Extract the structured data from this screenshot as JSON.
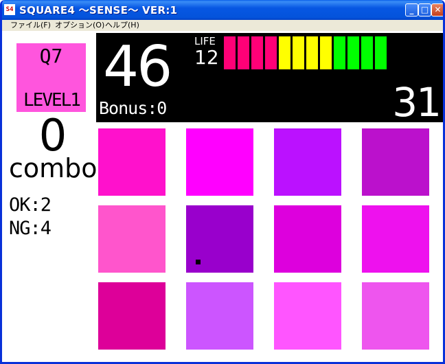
{
  "window": {
    "title": "SQUARE4 ～SENSE～ VER:1",
    "icon_text": "S4"
  },
  "menu": [
    {
      "label": "ファイル(F)"
    },
    {
      "label": "オプション(O)"
    },
    {
      "label": "ヘルプ(H)"
    }
  ],
  "titlebar_buttons": {
    "minimize": "_",
    "maximize": "□",
    "close": "✕"
  },
  "question": {
    "label": "Q7",
    "level": "LEVEL1",
    "color": "#ff55dd"
  },
  "combo": {
    "count": "0",
    "label": "combo"
  },
  "stats": {
    "ok": "OK:2",
    "ng": "NG:4"
  },
  "hud": {
    "time": "46",
    "bonus": "Bonus:0",
    "life_label": "LIFE",
    "life_value": "12",
    "score": "31",
    "life_segments": [
      "#ff0077",
      "#ff0077",
      "#ff0077",
      "#ff0077",
      "#ffff00",
      "#ffff00",
      "#ffff00",
      "#ffff00",
      "#00ff00",
      "#00ff00",
      "#00ff00",
      "#00ff00"
    ]
  },
  "tiles": [
    {
      "color": "#ff11cc"
    },
    {
      "color": "#ff00ff"
    },
    {
      "color": "#bb11ff"
    },
    {
      "color": "#bb11cc"
    },
    {
      "color": "#ff55cc"
    },
    {
      "color": "#9900cc"
    },
    {
      "color": "#dd00dd"
    },
    {
      "color": "#ee11ee"
    },
    {
      "color": "#dd0099"
    },
    {
      "color": "#cc55ff"
    },
    {
      "color": "#ff55ff"
    },
    {
      "color": "#ee55ee"
    }
  ],
  "cursor_tile": 5
}
